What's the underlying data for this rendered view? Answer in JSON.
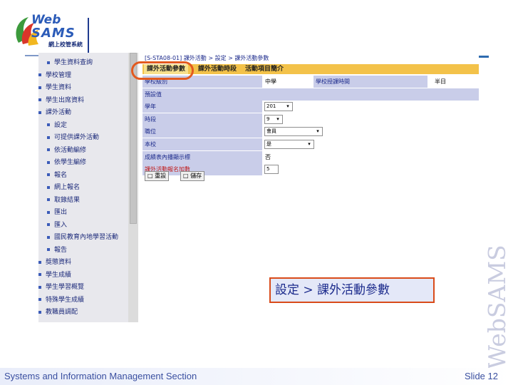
{
  "logo": {
    "web": "Web",
    "sams": "SAMS",
    "subtitle": "網上校管系統"
  },
  "sidebar": {
    "items": [
      {
        "label": "學生資料查詢",
        "level": 1
      },
      {
        "label": "學校管理",
        "level": 0
      },
      {
        "label": "學生資料",
        "level": 0
      },
      {
        "label": "學生出席資料",
        "level": 0
      },
      {
        "label": "課外活動",
        "level": 0
      },
      {
        "label": "設定",
        "level": 1
      },
      {
        "label": "可提供課外活動",
        "level": 1
      },
      {
        "label": "依活動編修",
        "level": 1
      },
      {
        "label": "依學生編修",
        "level": 1
      },
      {
        "label": "報名",
        "level": 1
      },
      {
        "label": "網上報名",
        "level": 1
      },
      {
        "label": "取錄結果",
        "level": 1
      },
      {
        "label": "匯出",
        "level": 1
      },
      {
        "label": "匯入",
        "level": 1
      },
      {
        "label": "國民教育內地學習活動",
        "level": 1
      },
      {
        "label": "報告",
        "level": 1
      },
      {
        "label": "獎懲資料",
        "level": 0
      },
      {
        "label": "學生成績",
        "level": 0
      },
      {
        "label": "學生學習概覽",
        "level": 0
      },
      {
        "label": "特殊學生成績",
        "level": 0
      },
      {
        "label": "教職員調配",
        "level": 0
      }
    ]
  },
  "main": {
    "breadcrumb": "[S-STA08-01] 課外活動 > 設定 > 課外活動參數",
    "tabs": [
      "課外活動參數",
      "課外活動時段",
      "活動項目簡介"
    ],
    "header": {
      "col1": "學校級別",
      "col1_val": "中學",
      "col2": "學校授課時間",
      "col2_val": "半日"
    },
    "section": "預設值",
    "rows": [
      {
        "label": "學年",
        "value": "201",
        "kind": "select"
      },
      {
        "label": "時段",
        "value": "9",
        "kind": "select"
      },
      {
        "label": "職位",
        "value": "會員",
        "kind": "select"
      },
      {
        "label": "本校",
        "value": "是",
        "kind": "select"
      },
      {
        "label": "成績表內播顯示標",
        "value": "否",
        "kind": "text"
      },
      {
        "label": "課外活動報名加數",
        "value": "5",
        "kind": "input",
        "red": true
      }
    ],
    "buttons": {
      "reset": "重設",
      "save": "儲存"
    }
  },
  "callout": "設定 > 課外活動參數",
  "watermark": "WebSAMS",
  "footer": {
    "left": "Systems and Information Management Section",
    "right": "Slide 12"
  },
  "colors": {
    "accent": "#2b5bb8",
    "tab_bar": "#f3c24a",
    "label_bg": "#c9cde9",
    "highlight": "#e35a1f"
  }
}
